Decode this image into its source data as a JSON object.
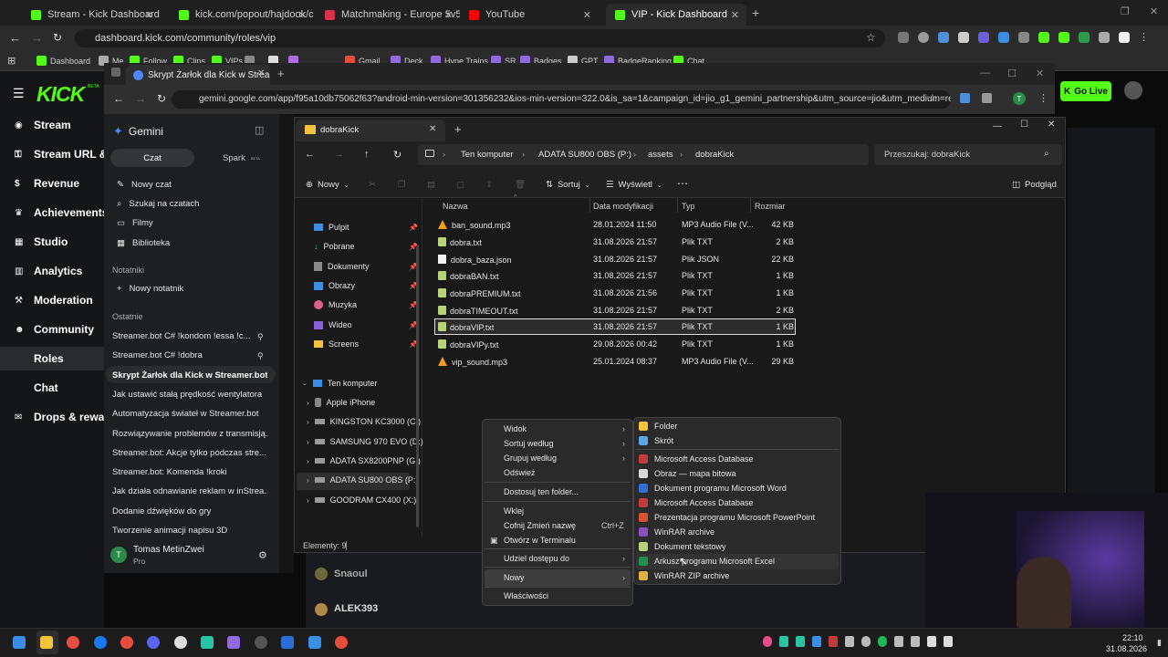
{
  "chrome": {
    "tabs": [
      {
        "label": "Stream - Kick Dashboard",
        "active": false
      },
      {
        "label": "kick.com/popout/hajdook/chat",
        "active": false
      },
      {
        "label": "Matchmaking - Europe 5v5 Qu",
        "active": false
      },
      {
        "label": "YouTube",
        "active": false
      },
      {
        "label": "VIP - Kick Dashboard",
        "active": true
      }
    ],
    "url": "dashboard.kick.com/community/roles/vip",
    "bookmarks": [
      "Dashboard",
      "Me",
      "Follow",
      "Clips",
      "VIPs",
      "",
      "",
      "",
      "Gmail",
      "Deck",
      "Hype Trains",
      "SR",
      "Badges",
      "GPT",
      "BadgeRanking",
      "Chat"
    ]
  },
  "kick": {
    "logo": "KICK",
    "logo_beta": "BETA",
    "go_live": "Go Live",
    "nav": [
      "Stream",
      "Stream URL & K",
      "Revenue",
      "Achievements",
      "Studio",
      "Analytics",
      "Moderation",
      "Community",
      "Roles",
      "Chat",
      "Drops & reward"
    ],
    "active_nav": "Roles",
    "bottom_names": [
      "Snaoul",
      "ALEK393"
    ]
  },
  "gemini": {
    "tab_title": "Skrypt Żarłok dla Kick w Stream",
    "url": "gemini.google.com/app/f95a10db75062f63?android-min-version=301356232&ios-min-version=322.0&is_sa=1&campaign_id=jio_g1_gemini_partnership&utm_source=jio&utm_medium=ref...",
    "brand": "Gemini",
    "tab_chat": "Czat",
    "tab_spark": "Spark",
    "spark_badge": "BETA",
    "menu": [
      "Nowy czat",
      "Szukaj na czatach",
      "Filmy",
      "Biblioteka"
    ],
    "notebooks_heading": "Notatniki",
    "new_notebook": "Nowy notatnik",
    "recent_heading": "Ostatnie",
    "recent": [
      "Streamer.bot C# !kondom !essa !c...",
      "Streamer.bot C# !dobra",
      "Skrypt Żarłok dla Kick w Streamer.bot",
      "Jak ustawić stałą prędkość wentylatora",
      "Automatyzacja świateł w Streamer.bot",
      "Rozwiązywanie problemów z transmisją...",
      "Streamer.bot: Akcje tylko podczas stre...",
      "Streamer.bot: Komenda !kroki",
      "Jak działa odnawianie reklam w inStrea...",
      "Dodanie dźwięków do gry",
      "Tworzenie animacji napisu 3D"
    ],
    "active_recent": 2,
    "user_initial": "T",
    "user_name": "Tomas MetinZwei",
    "user_plan": "Pro"
  },
  "explorer": {
    "tab_title": "dobraKick",
    "breadcrumb": [
      "Ten komputer",
      "ADATA SU800 OBS (P:)",
      "assets",
      "dobraKick"
    ],
    "search_placeholder": "Przeszukaj: dobraKick",
    "toolbar": {
      "new": "Nowy",
      "sort": "Sortuj",
      "view": "Wyświetl",
      "preview": "Podgląd"
    },
    "quick_access": [
      "Pulpit",
      "Pobrane",
      "Dokumenty",
      "Obrazy",
      "Muzyka",
      "Wideo",
      "Screens"
    ],
    "this_pc": "Ten komputer",
    "drives": [
      "Apple iPhone",
      "KINGSTON KC3000 (C:)",
      "SAMSUNG 970 EVO (D:)",
      "ADATA SX8200PNP (G:)",
      "ADATA SU800 OBS (P:)",
      "GOODRAM CX400 (X:)"
    ],
    "selected_drive": "ADATA SU800 OBS (P:)",
    "columns": [
      "Nazwa",
      "Data modyfikacji",
      "Typ",
      "Rozmiar"
    ],
    "files": [
      {
        "name": "ban_sound.mp3",
        "date": "28.01.2024 11:50",
        "type": "MP3 Audio File (V...",
        "size": "42 KB",
        "kind": "mp3"
      },
      {
        "name": "dobra.txt",
        "date": "31.08.2026 21:57",
        "type": "Plik TXT",
        "size": "2 KB",
        "kind": "txt"
      },
      {
        "name": "dobra_baza.json",
        "date": "31.08.2026 21:57",
        "type": "Plik JSON",
        "size": "22 KB",
        "kind": "json"
      },
      {
        "name": "dobraBAN.txt",
        "date": "31.08.2026 21:57",
        "type": "Plik TXT",
        "size": "1 KB",
        "kind": "txt"
      },
      {
        "name": "dobraPREMIUM.txt",
        "date": "31.08.2026 21:56",
        "type": "Plik TXT",
        "size": "1 KB",
        "kind": "txt"
      },
      {
        "name": "dobraTIMEOUT.txt",
        "date": "31.08.2026 21:57",
        "type": "Plik TXT",
        "size": "2 KB",
        "kind": "txt"
      },
      {
        "name": "dobraVIP.txt",
        "date": "31.08.2026 21:57",
        "type": "Plik TXT",
        "size": "1 KB",
        "kind": "txt"
      },
      {
        "name": "dobraVIPy.txt",
        "date": "29.08.2026 00:42",
        "type": "Plik TXT",
        "size": "1 KB",
        "kind": "txt"
      },
      {
        "name": "vip_sound.mp3",
        "date": "25.01.2024 08:37",
        "type": "MP3 Audio File (V...",
        "size": "29 KB",
        "kind": "mp3"
      }
    ],
    "selected_file": "dobraVIP.txt",
    "status": "Elementy: 9"
  },
  "context_menu": {
    "items": [
      "Widok",
      "Sortuj według",
      "Grupuj według",
      "Odśwież",
      "Dostosuj ten folder...",
      "Wklej",
      "Cofnij Zmień nazwę",
      "Otwórz w Terminalu",
      "Udziel dostępu do",
      "Nowy",
      "Właściwości"
    ],
    "undo_shortcut": "Ctrl+Z",
    "highlighted": "Nowy"
  },
  "submenu_new": {
    "items": [
      {
        "label": "Folder",
        "color": "#f3c33c"
      },
      {
        "label": "Skrót",
        "color": "#5aa7e8"
      },
      {
        "label": "Microsoft Access Database",
        "color": "#c23b3b"
      },
      {
        "label": "Obraz — mapa bitowa",
        "color": "#d9d9d9"
      },
      {
        "label": "Dokument programu Microsoft Word",
        "color": "#2f6fd6"
      },
      {
        "label": "Microsoft Access Database",
        "color": "#c23b3b"
      },
      {
        "label": "Prezentacja programu Microsoft PowerPoint",
        "color": "#d8532c"
      },
      {
        "label": "WinRAR archive",
        "color": "#8a4fc2"
      },
      {
        "label": "Dokument tekstowy",
        "color": "#b8d27a"
      },
      {
        "label": "Arkusz programu Microsoft Excel",
        "color": "#1f8f4e"
      },
      {
        "label": "WinRAR ZIP archive",
        "color": "#e0b040"
      }
    ]
  },
  "taskbar": {
    "time": "22:10",
    "date": "31.08.2026"
  },
  "colors": {
    "kick_green": "#53fc18",
    "selection": "#2c2c2c"
  }
}
